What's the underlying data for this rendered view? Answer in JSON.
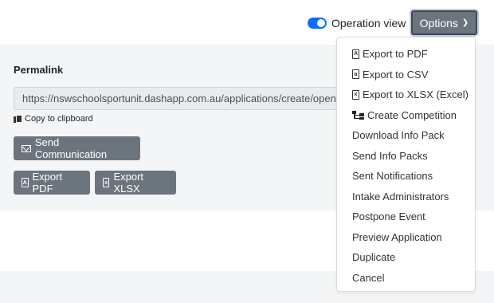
{
  "header": {
    "operation_view_label": "Operation view",
    "operation_view_on": true,
    "options_label": "Options",
    "options_icon": "chevron-down-icon"
  },
  "permalink": {
    "title": "Permalink",
    "url": "https://nswschoolsportunit.dashapp.com.au/applications/create/open/",
    "copy_label": "Copy to clipboard"
  },
  "actions": {
    "send_communication": "Send Communication",
    "export_pdf": "Export PDF",
    "export_xlsx": "Export XLSX"
  },
  "dropdown": {
    "items": [
      {
        "label": "Export to PDF",
        "icon": "file-pdf-icon"
      },
      {
        "label": "Export to CSV",
        "icon": "file-csv-icon"
      },
      {
        "label": "Export to XLSX (Excel)",
        "icon": "file-excel-icon"
      },
      {
        "label": "Create Competition",
        "icon": "sitemap-icon"
      },
      {
        "label": "Download Info Pack"
      },
      {
        "label": "Send Info Packs"
      },
      {
        "label": "Sent Notifications"
      },
      {
        "label": "Intake Administrators"
      },
      {
        "label": "Postpone Event"
      },
      {
        "label": "Preview Application"
      },
      {
        "label": "Duplicate"
      },
      {
        "label": "Cancel"
      }
    ]
  },
  "colors": {
    "toggle_on": "#0d6efd",
    "button_gray": "#6c757d",
    "panel_bg": "#f4f5f6"
  }
}
